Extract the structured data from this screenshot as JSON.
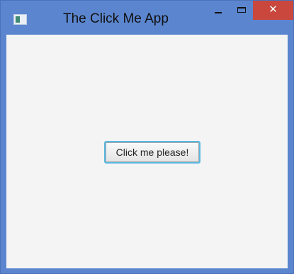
{
  "window": {
    "title": "The Click Me App",
    "app_icon": "java-window-icon",
    "controls": {
      "minimize_icon": "minimize-icon",
      "maximize_icon": "maximize-icon",
      "close_icon": "close-icon",
      "close_glyph": "✕"
    }
  },
  "main": {
    "button_label": "Click me please!"
  },
  "colors": {
    "title_bar": "#5b86cf",
    "close_button": "#c9473d",
    "client_background": "#f4f4f4",
    "button_focus_border": "#5ab9e3"
  }
}
